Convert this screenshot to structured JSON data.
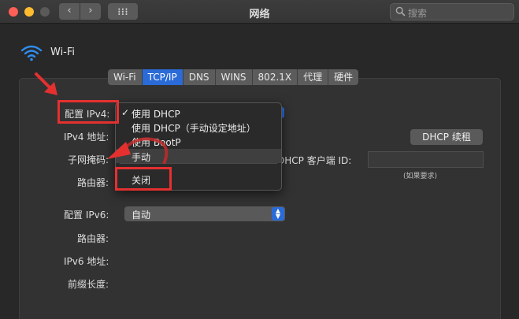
{
  "window": {
    "title": "网络",
    "search_placeholder": "搜索",
    "back_glyph": "‹",
    "forward_glyph": "›"
  },
  "network": {
    "service_name": "Wi-Fi"
  },
  "tabs": [
    {
      "label": "Wi-Fi",
      "active": false
    },
    {
      "label": "TCP/IP",
      "active": true
    },
    {
      "label": "DNS",
      "active": false
    },
    {
      "label": "WINS",
      "active": false
    },
    {
      "label": "802.1X",
      "active": false
    },
    {
      "label": "代理",
      "active": false
    },
    {
      "label": "硬件",
      "active": false
    }
  ],
  "ipv4": {
    "config_label": "配置 IPv4:",
    "address_label": "IPv4 地址:",
    "subnet_label": "子网掩码:",
    "router_label": "路由器:",
    "dhcp_renew_button": "DHCP 续租",
    "dhcp_client_id_label": "DHCP 客户端 ID:",
    "dhcp_client_id_value": "",
    "dhcp_client_id_hint": "(如果要求)"
  },
  "ipv4_menu": {
    "check_glyph": "✓",
    "items": [
      {
        "label": "使用 DHCP",
        "checked": true
      },
      {
        "label": "使用 DHCP（手动设定地址）",
        "checked": false
      },
      {
        "label": "使用 BootP",
        "checked": false
      },
      {
        "label": "手动",
        "checked": false
      },
      {
        "label": "关闭",
        "checked": false
      }
    ]
  },
  "ipv6": {
    "config_label": "配置 IPv6:",
    "config_value": "自动",
    "router_label": "路由器:",
    "address_label": "IPv6 地址:",
    "prefix_label": "前缀长度:"
  },
  "colors": {
    "accent": "#2a6bd8",
    "annotation_red": "#e53030",
    "background": "#282828"
  }
}
